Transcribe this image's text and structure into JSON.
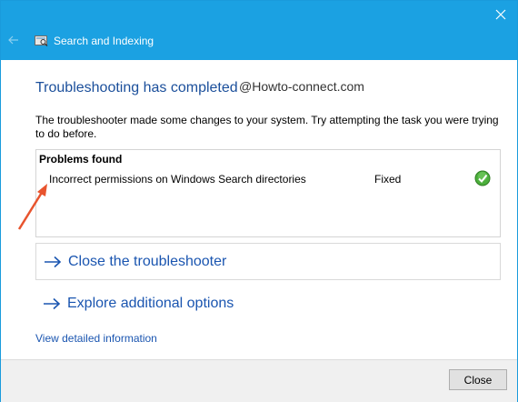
{
  "window": {
    "title": "Search and Indexing",
    "title_bar_color": "#1ba1e2",
    "icons": {
      "close": "close-icon",
      "back": "back-arrow-icon",
      "app": "search-indexing-icon"
    }
  },
  "main": {
    "heading": "Troubleshooting has completed",
    "watermark": "@Howto-connect.com",
    "description": "The troubleshooter made some changes to your system. Try attempting the task you were trying to do before.",
    "problems": {
      "header": "Problems found",
      "items": [
        {
          "description": "Incorrect permissions on Windows Search directories",
          "status": "Fixed",
          "status_icon": "green-check-icon"
        }
      ]
    },
    "commands": [
      {
        "label": "Close the troubleshooter",
        "icon": "right-arrow-icon"
      },
      {
        "label": "Explore additional options",
        "icon": "right-arrow-icon"
      }
    ],
    "detail_link": "View detailed information",
    "link_color": "#1a55b0",
    "annotation_arrow_color": "#e8542e"
  },
  "footer": {
    "close_label": "Close"
  }
}
